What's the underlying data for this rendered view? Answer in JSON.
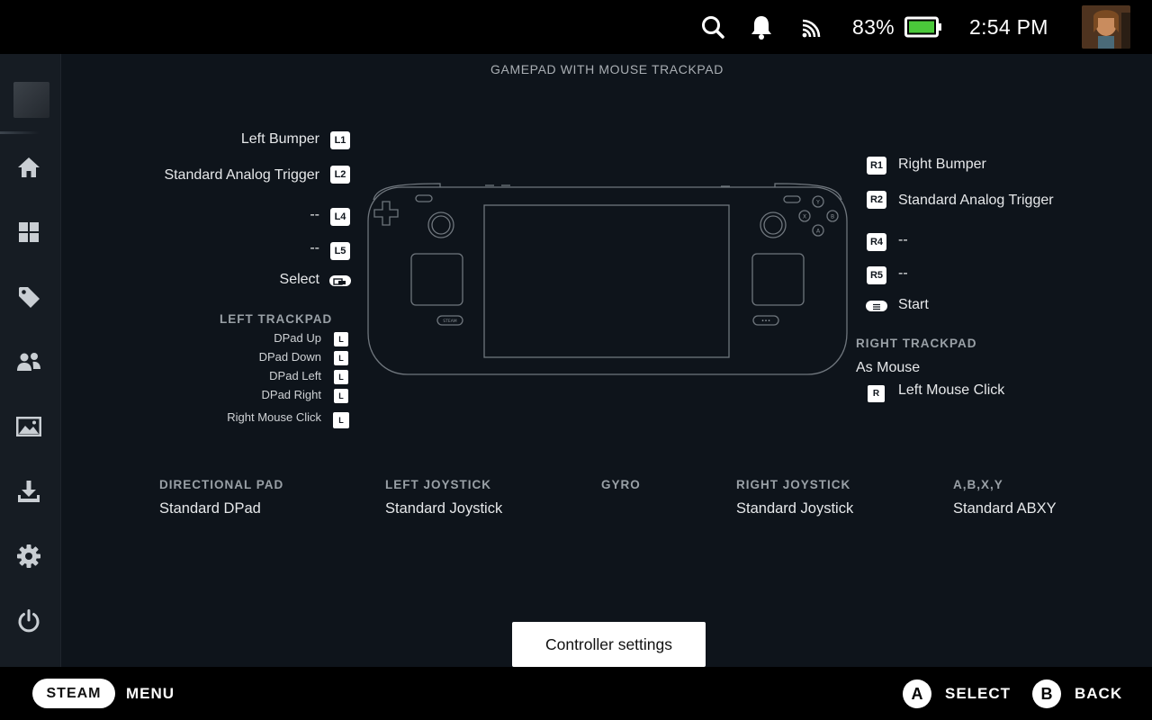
{
  "status_bar": {
    "battery_percent": "83%",
    "time": "2:54 PM",
    "icons": [
      "search-icon",
      "bell-icon",
      "wifi-icon",
      "battery-icon"
    ],
    "battery_level": 0.83
  },
  "sidebar": {
    "items": [
      {
        "name": "home",
        "icon": "home-icon"
      },
      {
        "name": "library",
        "icon": "grid-icon"
      },
      {
        "name": "store",
        "icon": "tag-icon"
      },
      {
        "name": "friends",
        "icon": "people-icon"
      },
      {
        "name": "media",
        "icon": "image-icon"
      },
      {
        "name": "downloads",
        "icon": "download-icon"
      },
      {
        "name": "settings",
        "icon": "gear-icon"
      },
      {
        "name": "power",
        "icon": "power-icon"
      }
    ]
  },
  "layout": {
    "title": "GAMEPAD WITH MOUSE TRACKPAD",
    "left": {
      "l1": {
        "label": "Left Bumper",
        "badge": "L1"
      },
      "l2": {
        "label": "Standard Analog Trigger",
        "badge": "L2"
      },
      "l4": {
        "label": "--",
        "badge": "L4"
      },
      "l5": {
        "label": "--",
        "badge": "L5"
      },
      "select": {
        "label": "Select"
      },
      "trackpad_header": "LEFT TRACKPAD",
      "trackpad_items": [
        {
          "label": "DPad Up"
        },
        {
          "label": "DPad Down"
        },
        {
          "label": "DPad Left"
        },
        {
          "label": "DPad Right"
        },
        {
          "label": "Right Mouse Click"
        }
      ],
      "trackpad_badge": "L"
    },
    "right": {
      "r1": {
        "label": "Right Bumper",
        "badge": "R1"
      },
      "r2": {
        "label": "Standard Analog Trigger",
        "badge": "R2"
      },
      "r4": {
        "label": "--",
        "badge": "R4"
      },
      "r5": {
        "label": "--",
        "badge": "R5"
      },
      "start": {
        "label": "Start"
      },
      "trackpad_header": "RIGHT TRACKPAD",
      "trackpad_mode": "As Mouse",
      "trackpad_click": "Left Mouse Click",
      "trackpad_badge": "R"
    },
    "device": {
      "steam_label": "STEAM",
      "face_buttons": [
        "Y",
        "X",
        "B",
        "A"
      ]
    },
    "bottom": [
      {
        "header": "DIRECTIONAL PAD",
        "value": "Standard DPad"
      },
      {
        "header": "LEFT JOYSTICK",
        "value": "Standard Joystick"
      },
      {
        "header": "GYRO",
        "value": ""
      },
      {
        "header": "RIGHT JOYSTICK",
        "value": "Standard Joystick"
      },
      {
        "header": "A,B,X,Y",
        "value": "Standard ABXY"
      }
    ],
    "settings_button": "Controller settings"
  },
  "footer": {
    "steam": "STEAM",
    "menu": "MENU",
    "a_glyph": "A",
    "select": "SELECT",
    "b_glyph": "B",
    "back": "BACK"
  }
}
